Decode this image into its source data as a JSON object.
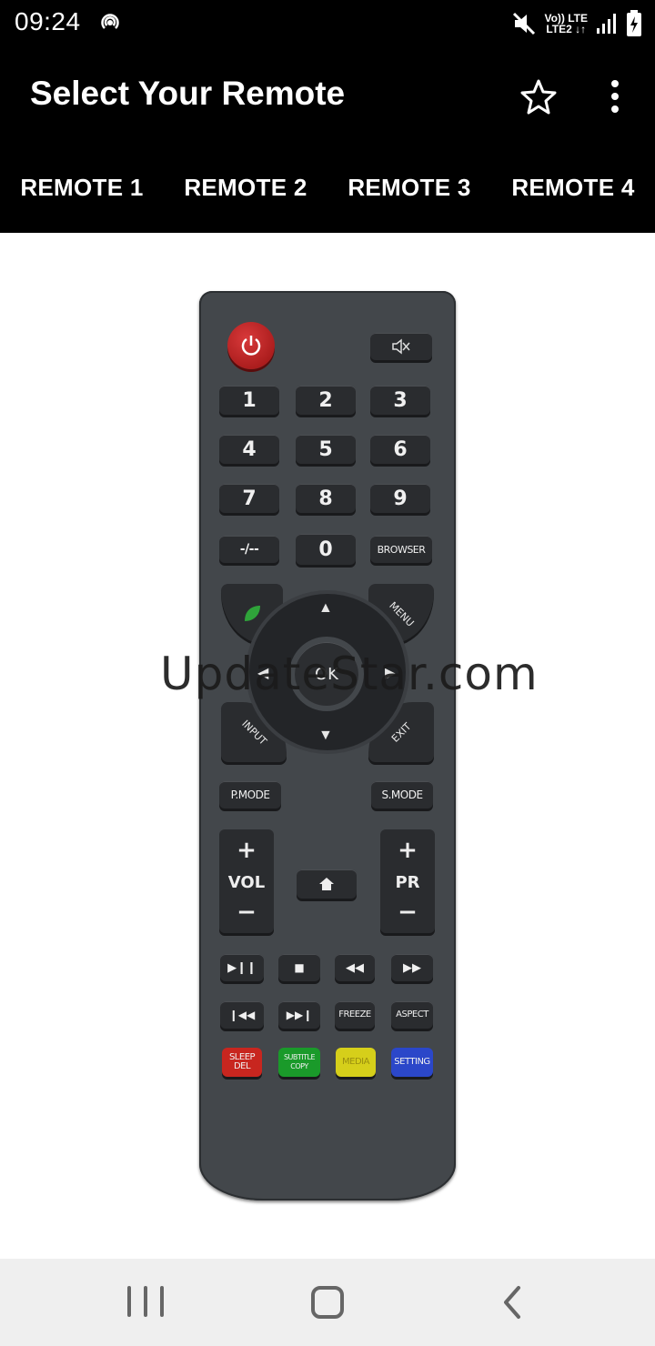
{
  "status_bar": {
    "time": "09:24",
    "network_top": "Vo)) LTE",
    "network_bottom": "LTE2 ↓↑"
  },
  "app_bar": {
    "title": "Select Your Remote"
  },
  "tabs": [
    {
      "label": "REMOTE 1"
    },
    {
      "label": "REMOTE 2"
    },
    {
      "label": "REMOTE 3"
    },
    {
      "label": "REMOTE 4"
    }
  ],
  "remote": {
    "numbers": [
      "1",
      "2",
      "3",
      "4",
      "5",
      "6",
      "7",
      "8",
      "9"
    ],
    "dash": "-/--",
    "zero": "0",
    "browser": "BROWSER",
    "menu": "MENU",
    "input": "INPUT",
    "exit": "EXIT",
    "ok": "OK",
    "pmode": "P.MODE",
    "smode": "S.MODE",
    "vol": "VOL",
    "pr": "PR",
    "freeze": "FREEZE",
    "aspect": "ASPECT",
    "sleep": "SLEEP DEL",
    "subtitle": "SUBTITLE COPY",
    "media": "MEDIA",
    "setting": "SETTING",
    "colors": {
      "red": "#c8261f",
      "green": "#1a9a2a",
      "yellow": "#d6cf1a",
      "blue": "#2b47c9"
    }
  },
  "watermark": "UpdateStar.com"
}
